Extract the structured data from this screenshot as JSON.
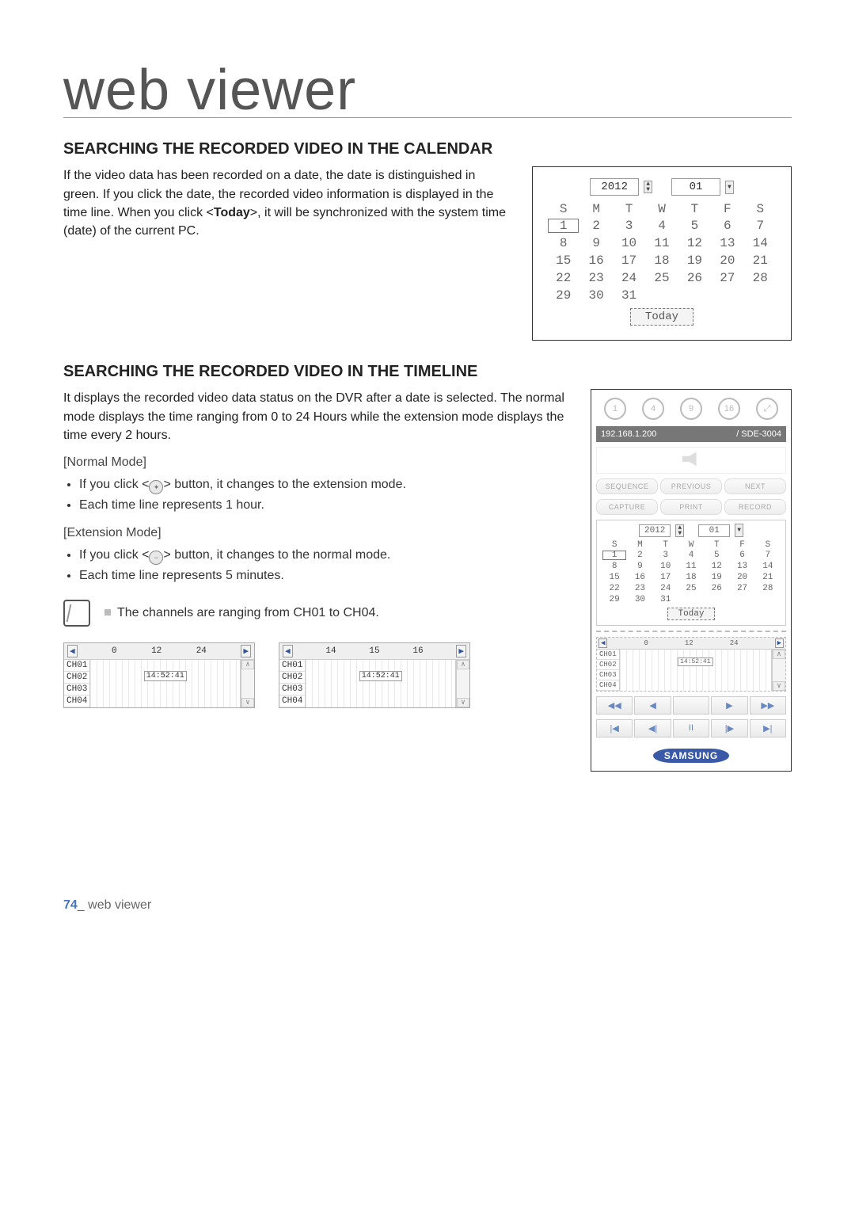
{
  "page": {
    "doc_title": "web viewer",
    "footer_num": "74",
    "footer_sep": "_",
    "footer_label": "web viewer",
    "section1": {
      "heading": "SEARCHING THE RECORDED VIDEO IN THE CALENDAR",
      "intro_pre": "If the video data has been recorded on a date, the date is distinguished in green. If you click the date, the recorded video information is displayed in the time line. When you click <",
      "intro_bold": "Today",
      "intro_post": ">, it will be synchronized with the system time (date) of the current PC."
    },
    "section2": {
      "heading": "SEARCHING THE RECORDED VIDEO IN THE TIMELINE",
      "intro": "It displays the recorded video data status on the DVR after a date is selected. The normal mode displays the time ranging from 0 to 24 Hours while the extension mode displays the time every 2 hours.",
      "normal_label": "[Normal Mode]",
      "normal_b1_pre": "If you click <",
      "normal_b1_post": "> button, it changes to the extension mode.",
      "normal_b2": "Each time line represents 1 hour.",
      "ext_label": "[Extension Mode]",
      "ext_b1_pre": "If you click <",
      "ext_b1_post": "> button, it changes to the normal mode.",
      "ext_b2": "Each time line represents 5 minutes.",
      "note": "The channels are ranging from CH01 to CH04."
    },
    "calendar": {
      "year": "2012",
      "month": "01",
      "days_hdr": [
        "S",
        "M",
        "T",
        "W",
        "T",
        "F",
        "S"
      ],
      "days": [
        "1",
        "2",
        "3",
        "4",
        "5",
        "6",
        "7",
        "8",
        "9",
        "10",
        "11",
        "12",
        "13",
        "14",
        "15",
        "16",
        "17",
        "18",
        "19",
        "20",
        "21",
        "22",
        "23",
        "24",
        "25",
        "26",
        "27",
        "28",
        "29",
        "30",
        "31"
      ],
      "selected": "1",
      "today_label": "Today"
    },
    "timeline_normal": {
      "start": "0",
      "mid": "12",
      "end": "24",
      "time_marker": "14:52:41",
      "channels": [
        "CH01",
        "CH02",
        "CH03",
        "CH04"
      ]
    },
    "timeline_ext": {
      "start": "14",
      "mid": "15",
      "end": "16",
      "time_marker": "14:52:41",
      "channels": [
        "CH01",
        "CH02",
        "CH03",
        "CH04"
      ]
    },
    "app": {
      "layouts": [
        "1",
        "4",
        "9",
        "16",
        "⤢"
      ],
      "ip": "192.168.1.200",
      "model_sep": "/",
      "model": "SDE-3004",
      "btns1": [
        "SEQUENCE",
        "PREVIOUS",
        "NEXT"
      ],
      "btns2": [
        "CAPTURE",
        "PRINT",
        "RECORD"
      ],
      "transport1": [
        "◀◀",
        "◀",
        "",
        "▶",
        "▶▶"
      ],
      "transport2": [
        "|◀",
        "◀|",
        "II",
        "|▶",
        "▶|"
      ],
      "brand": "SAMSUNG"
    }
  }
}
